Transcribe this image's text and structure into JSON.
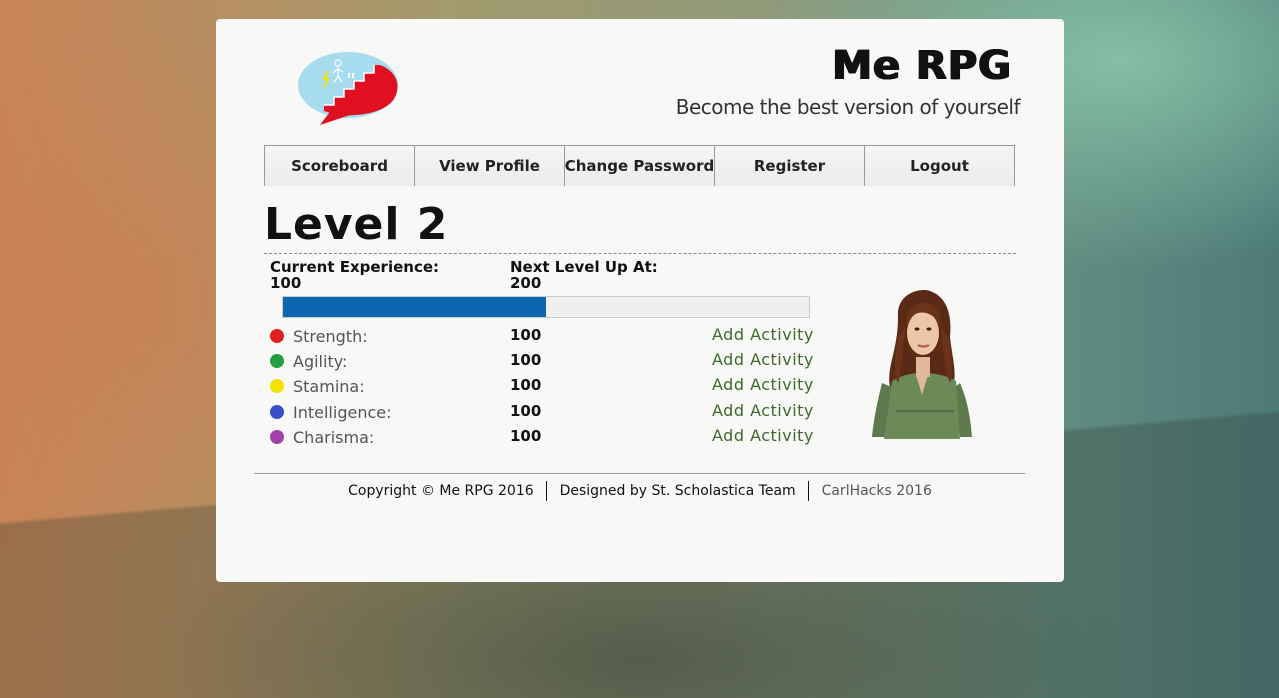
{
  "header": {
    "title": "Me RPG",
    "tagline": "Become the best version of yourself"
  },
  "nav": [
    {
      "label": "Scoreboard"
    },
    {
      "label": "View Profile"
    },
    {
      "label": "Change Password"
    },
    {
      "label": "Register"
    },
    {
      "label": "Logout"
    }
  ],
  "level": {
    "title": "Level 2",
    "current_label": "Current Experience:",
    "current_value": "100",
    "next_label": "Next Level Up At:",
    "next_value": "200",
    "progress_fraction": 0.5
  },
  "stats": [
    {
      "name": "Strength:",
      "value": "100",
      "action": "Add Activity",
      "color": "#e02020"
    },
    {
      "name": "Agility:",
      "value": "100",
      "action": "Add Activity",
      "color": "#22a040"
    },
    {
      "name": "Stamina:",
      "value": "100",
      "action": "Add Activity",
      "color": "#f2e000"
    },
    {
      "name": "Intelligence:",
      "value": "100",
      "action": "Add Activity",
      "color": "#3a4ec8"
    },
    {
      "name": "Charisma:",
      "value": "100",
      "action": "Add Activity",
      "color": "#a040a8"
    }
  ],
  "footer": {
    "copyright": "Copyright © Me RPG 2016",
    "designed_by": "Designed by St. Scholastica Team",
    "event_link": "CarlHacks 2016"
  },
  "colors": {
    "accent": "#0d66b0",
    "link": "#3d6a2a",
    "logo_bubble": "#a6dcee",
    "logo_stairs": "#e01020"
  }
}
